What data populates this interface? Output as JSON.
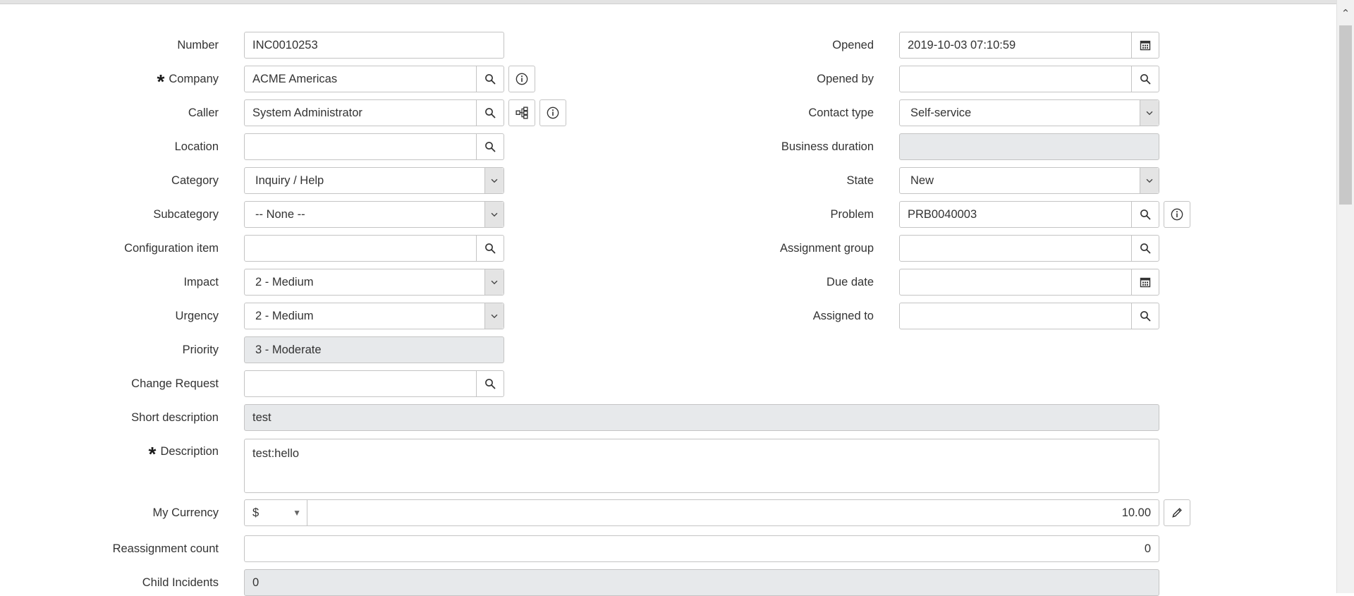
{
  "left": {
    "number": {
      "label": "Number",
      "value": "INC0010253"
    },
    "company": {
      "label": "Company",
      "value": "ACME Americas"
    },
    "caller": {
      "label": "Caller",
      "value": "System Administrator"
    },
    "location": {
      "label": "Location",
      "value": ""
    },
    "category": {
      "label": "Category",
      "value": "Inquiry / Help"
    },
    "subcategory": {
      "label": "Subcategory",
      "value": "-- None --"
    },
    "configuration_item": {
      "label": "Configuration item",
      "value": ""
    },
    "impact": {
      "label": "Impact",
      "value": "2 - Medium"
    },
    "urgency": {
      "label": "Urgency",
      "value": "2 - Medium"
    },
    "priority": {
      "label": "Priority",
      "value": "3 - Moderate"
    },
    "change_request": {
      "label": "Change Request",
      "value": ""
    }
  },
  "right": {
    "opened": {
      "label": "Opened",
      "value": "2019-10-03 07:10:59"
    },
    "opened_by": {
      "label": "Opened by",
      "value": ""
    },
    "contact_type": {
      "label": "Contact type",
      "value": "Self-service"
    },
    "business_duration": {
      "label": "Business duration",
      "value": ""
    },
    "state": {
      "label": "State",
      "value": "New"
    },
    "problem": {
      "label": "Problem",
      "value": "PRB0040003"
    },
    "assignment_group": {
      "label": "Assignment group",
      "value": ""
    },
    "due_date": {
      "label": "Due date",
      "value": ""
    },
    "assigned_to": {
      "label": "Assigned to",
      "value": ""
    }
  },
  "full": {
    "short_description": {
      "label": "Short description",
      "value": "test"
    },
    "description": {
      "label": "Description",
      "value": "test:hello"
    },
    "my_currency": {
      "label": "My Currency",
      "currency_symbol": "$",
      "value": "10.00"
    },
    "reassignment_count": {
      "label": "Reassignment count",
      "value": "0"
    },
    "child_incidents": {
      "label": "Child Incidents",
      "value": "0"
    }
  },
  "icons": {
    "mandatory": "asterisk-icon",
    "lookup": "search-icon",
    "info": "info-icon",
    "hierarchy": "hierarchy-icon",
    "calendar": "calendar-icon",
    "dropdown": "chevron-down-icon",
    "edit": "pencil-icon"
  },
  "colors": {
    "readonly_bg": "#e7e9eb",
    "border": "#c4c4c4",
    "select_btn": "#e4e4e4"
  }
}
